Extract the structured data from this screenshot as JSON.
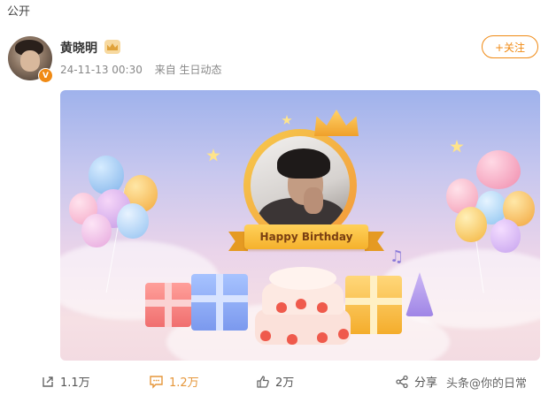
{
  "visibility": "公开",
  "post": {
    "username": "黄晓明",
    "timestamp": "24-11-13 00:30",
    "source": "来自 生日动态",
    "follow_label": "+关注",
    "avatar_badge": "V"
  },
  "card": {
    "banner_text": "Happy Birthday"
  },
  "actions": {
    "share_count": "1.1万",
    "comment_count": "1.2万",
    "like_count": "2万",
    "share_label": "分享"
  },
  "watermark": "头条@你的日常",
  "colors": {
    "accent": "#f08a14",
    "comment_highlight": "#e5963a"
  }
}
